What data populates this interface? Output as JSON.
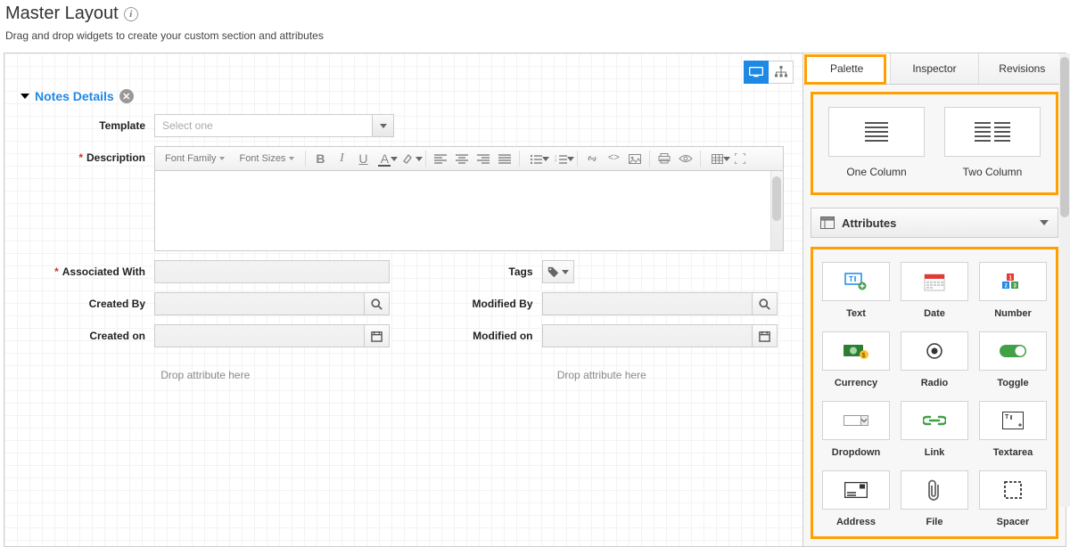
{
  "header": {
    "title": "Master Layout",
    "subtitle": "Drag and drop widgets to create your custom section and attributes"
  },
  "section": {
    "title": "Notes Details"
  },
  "form": {
    "template_label": "Template",
    "template_placeholder": "Select one",
    "description_label": "Description",
    "associated_with_label": "Associated With",
    "tags_label": "Tags",
    "created_by_label": "Created By",
    "modified_by_label": "Modified By",
    "created_on_label": "Created on",
    "modified_on_label": "Modified on",
    "drop_hint_left": "Drop attribute here",
    "drop_hint_right": "Drop attribute here"
  },
  "rte": {
    "font_family": "Font Family",
    "font_sizes": "Font Sizes"
  },
  "sidebar": {
    "tabs": {
      "palette": "Palette",
      "inspector": "Inspector",
      "revisions": "Revisions"
    },
    "layouts": {
      "one_column": "One Column",
      "two_column": "Two Column"
    },
    "attributes_title": "Attributes",
    "attrs": {
      "text": "Text",
      "date": "Date",
      "number": "Number",
      "currency": "Currency",
      "radio": "Radio",
      "toggle": "Toggle",
      "dropdown": "Dropdown",
      "link": "Link",
      "textarea": "Textarea",
      "address": "Address",
      "file": "File",
      "spacer": "Spacer"
    }
  }
}
